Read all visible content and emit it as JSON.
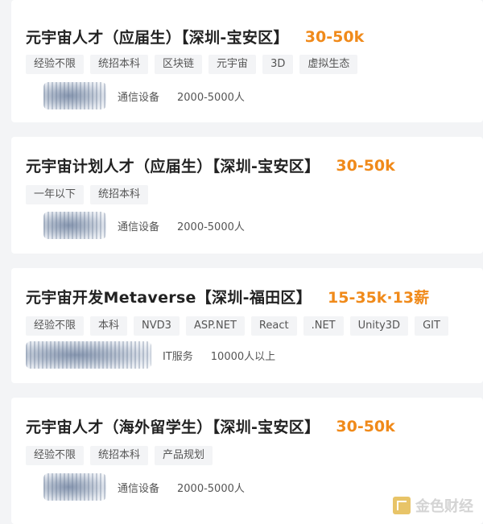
{
  "jobs": [
    {
      "title": "元宇宙人才（应届生）【深圳-宝安区】",
      "salary": "30-50k",
      "tags": [
        "经验不限",
        "统招本科",
        "区块链",
        "元宇宙",
        "3D",
        "虚拟生态"
      ],
      "industry": "通信设备",
      "size": "2000-5000人"
    },
    {
      "title": "元宇宙计划人才（应届生）【深圳-宝安区】",
      "salary": "30-50k",
      "tags": [
        "一年以下",
        "统招本科"
      ],
      "industry": "通信设备",
      "size": "2000-5000人"
    },
    {
      "title": "元宇宙开发Metaverse【深圳-福田区】",
      "salary": "15-35k·13薪",
      "tags": [
        "经验不限",
        "本科",
        "NVD3",
        "ASP.NET",
        "React",
        ".NET",
        "Unity3D",
        "GIT"
      ],
      "industry": "IT服务",
      "size": "10000人以上"
    },
    {
      "title": "元宇宙人才（海外留学生）【深圳-宝安区】",
      "salary": "30-50k",
      "tags": [
        "经验不限",
        "统招本科",
        "产品规划"
      ],
      "industry": "通信设备",
      "size": "2000-5000人"
    }
  ],
  "watermark": {
    "text": "金色财经",
    "icon": "jinse-logo-icon"
  },
  "colors": {
    "salary": "#f08a1a",
    "title": "#222222",
    "tag_bg": "#f3f4f6",
    "page_bg": "#f3f4f6"
  }
}
